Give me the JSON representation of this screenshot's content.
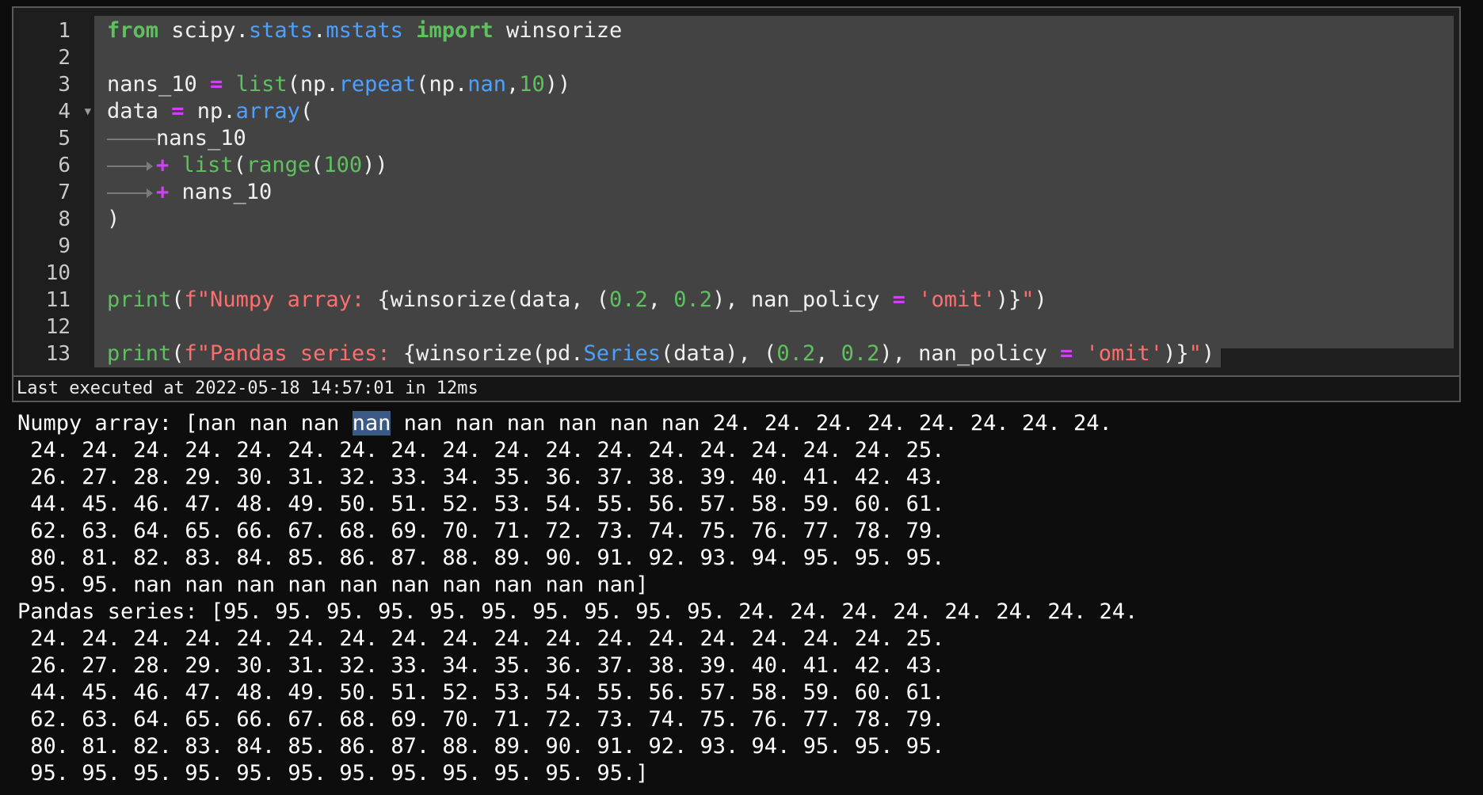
{
  "editor": {
    "line_numbers": [
      "1",
      "2",
      "3",
      "4",
      "5",
      "6",
      "7",
      "8",
      "9",
      "10",
      "11",
      "12",
      "13"
    ],
    "fold_marker": "▼",
    "tokens": {
      "l1": {
        "kw_from": "from",
        "pkg": " scipy.",
        "mod_stats": "stats",
        "dot": ".",
        "mod_mstats": "mstats",
        "sp": " ",
        "kw_import": "import",
        "name": " winsorize"
      },
      "l3": {
        "a": "nans_10 ",
        "op": "=",
        "b": " ",
        "list": "list",
        "c": "(np.",
        "repeat": "repeat",
        "d": "(np.",
        "nan": "nan",
        "e": ",",
        "ten": "10",
        "f": "))"
      },
      "l4": {
        "a": "data ",
        "op": "=",
        "b": " np.",
        "array": "array",
        "c": "("
      },
      "l5": {
        "a": "nans_10"
      },
      "l6": {
        "op": "+",
        "sp": " ",
        "list": "list",
        "b": "(",
        "range": "range",
        "c": "(",
        "hundred": "100",
        "d": "))"
      },
      "l7": {
        "op": "+",
        "a": " nans_10"
      },
      "l8": {
        "a": ")"
      },
      "l11": {
        "print": "print",
        "a": "(",
        "str1": "f\"Numpy array: ",
        "b": "{winsorize(data, (",
        "n1": "0.2",
        "c": ", ",
        "n2": "0.2",
        "d": "), nan_policy ",
        "op": "=",
        "e": " ",
        "str2": "'omit'",
        "f": ")}",
        "str3": "\"",
        "g": ")"
      },
      "l13": {
        "print": "print",
        "a": "(",
        "str1": "f\"Pandas series: ",
        "b": "{winsorize(pd.",
        "series": "Series",
        "c": "(data), (",
        "n1": "0.2",
        "d": ", ",
        "n2": "0.2",
        "e": "), nan_policy ",
        "op": "=",
        "f": " ",
        "str2": "'omit'",
        "g": ")}",
        "str3": "\"",
        "h": ")"
      }
    }
  },
  "status": {
    "text": "Last executed at 2022-05-18 14:57:01 in 12ms"
  },
  "output": {
    "numpy_prefix": "Numpy array: [nan nan nan ",
    "numpy_highlight": "nan",
    "numpy_rest": " nan nan nan nan nan nan 24. 24. 24. 24. 24. 24. 24. 24.",
    "numpy_lines": [
      " 24. 24. 24. 24. 24. 24. 24. 24. 24. 24. 24. 24. 24. 24. 24. 24. 24. 25.",
      " 26. 27. 28. 29. 30. 31. 32. 33. 34. 35. 36. 37. 38. 39. 40. 41. 42. 43.",
      " 44. 45. 46. 47. 48. 49. 50. 51. 52. 53. 54. 55. 56. 57. 58. 59. 60. 61.",
      " 62. 63. 64. 65. 66. 67. 68. 69. 70. 71. 72. 73. 74. 75. 76. 77. 78. 79.",
      " 80. 81. 82. 83. 84. 85. 86. 87. 88. 89. 90. 91. 92. 93. 94. 95. 95. 95.",
      " 95. 95. nan nan nan nan nan nan nan nan nan nan]"
    ],
    "pandas_lines": [
      "Pandas series: [95. 95. 95. 95. 95. 95. 95. 95. 95. 95. 24. 24. 24. 24. 24. 24. 24. 24.",
      " 24. 24. 24. 24. 24. 24. 24. 24. 24. 24. 24. 24. 24. 24. 24. 24. 24. 25.",
      " 26. 27. 28. 29. 30. 31. 32. 33. 34. 35. 36. 37. 38. 39. 40. 41. 42. 43.",
      " 44. 45. 46. 47. 48. 49. 50. 51. 52. 53. 54. 55. 56. 57. 58. 59. 60. 61.",
      " 62. 63. 64. 65. 66. 67. 68. 69. 70. 71. 72. 73. 74. 75. 76. 77. 78. 79.",
      " 80. 81. 82. 83. 84. 85. 86. 87. 88. 89. 90. 91. 92. 93. 94. 95. 95. 95.",
      " 95. 95. 95. 95. 95. 95. 95. 95. 95. 95. 95. 95.]"
    ]
  }
}
